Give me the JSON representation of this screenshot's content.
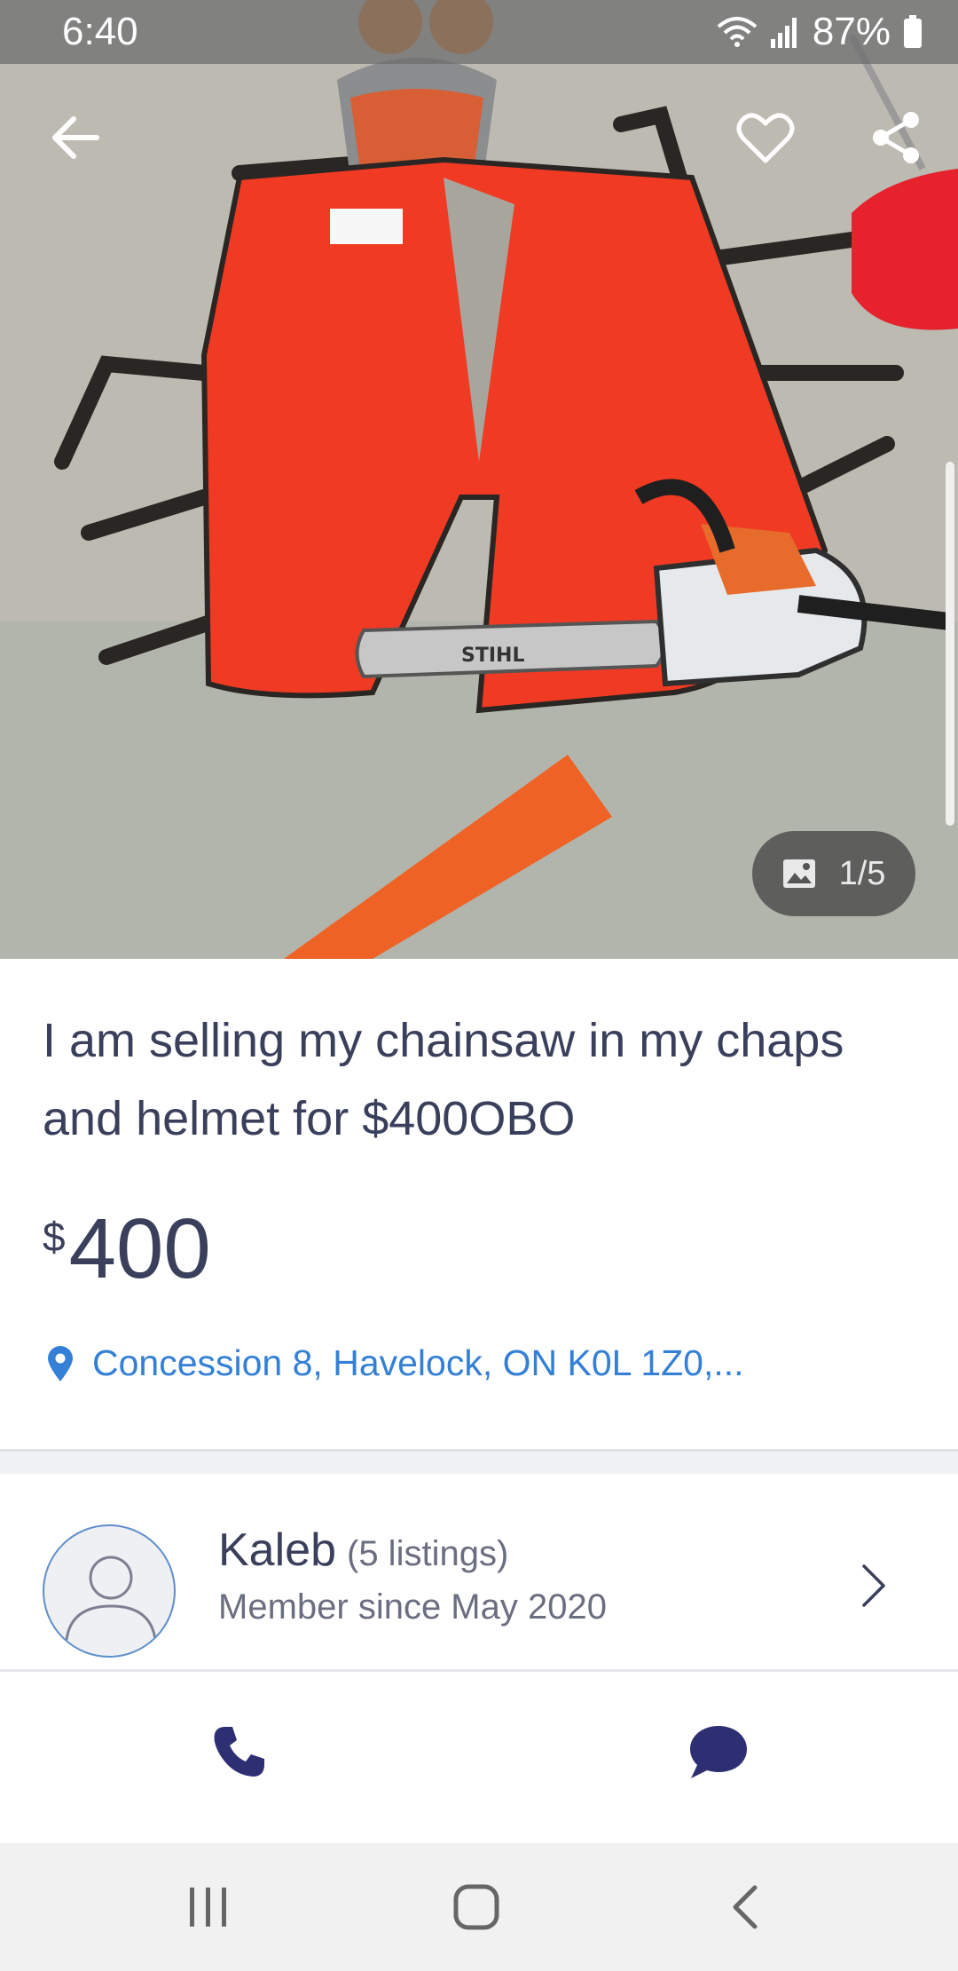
{
  "status_bar": {
    "time": "6:40",
    "battery": "87%",
    "icons": [
      "wifi-icon",
      "signal-icon",
      "battery-icon"
    ]
  },
  "photo": {
    "counter": "1/5",
    "icons": [
      "back-arrow-icon",
      "heart-icon",
      "share-icon",
      "image-icon"
    ]
  },
  "listing": {
    "title": "I am selling my chainsaw in my chaps and helmet for $400OBO",
    "price_currency": "$",
    "price_amount": "400",
    "location": "Concession 8, Havelock, ON K0L 1Z0,..."
  },
  "seller": {
    "name": "Kaleb",
    "listings": "(5 listings)",
    "member_since": "Member since May 2020"
  },
  "actions": {
    "icons": [
      "phone-icon",
      "chat-icon"
    ]
  },
  "nav_bar": {
    "icons": [
      "recents-icon",
      "home-icon",
      "back-icon"
    ]
  },
  "colors": {
    "text_dark": "#3a3f5c",
    "text_muted": "#6b6e80",
    "link_blue": "#3480d6",
    "action_navy": "#2e2f72"
  }
}
